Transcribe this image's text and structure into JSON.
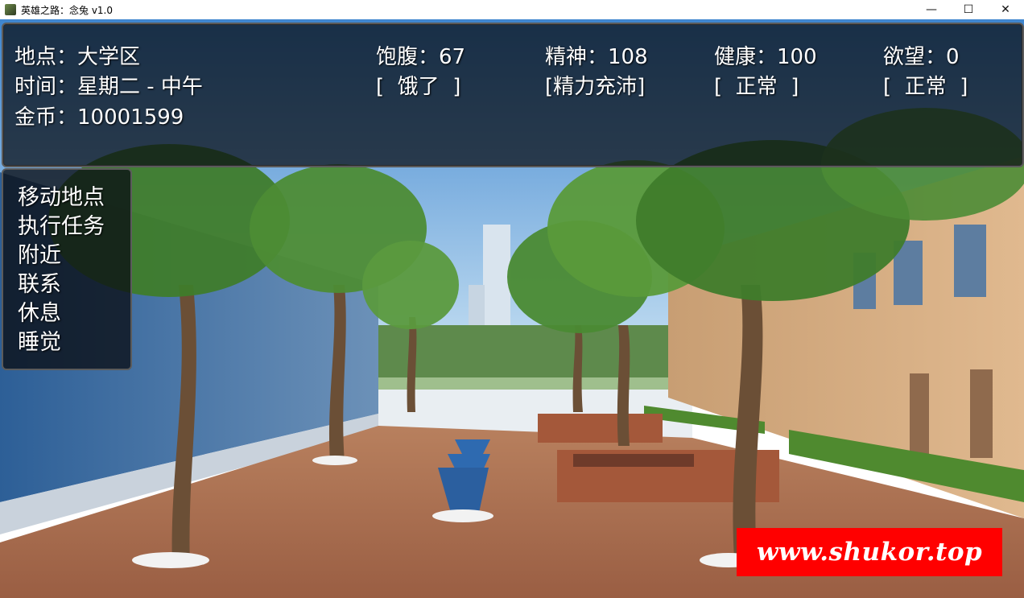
{
  "window": {
    "title": "英雄之路：念兔 v1.0",
    "minimize": "—",
    "maximize": "☐",
    "close": "✕"
  },
  "status": {
    "location": "地点：大学区",
    "time": "时间：星期二 - 中午",
    "gold": "金币：10001599",
    "satiety": "饱腹：67",
    "satiety_state": "[  饿了  ]",
    "spirit": "精神：108",
    "spirit_state": "[精力充沛]",
    "health": "健康：100",
    "health_state": "[  正常  ]",
    "desire": "欲望：0",
    "desire_state": "[  正常  ]"
  },
  "menu": {
    "items": [
      "移动地点",
      "执行任务",
      "附近",
      "联系",
      "休息",
      "睡觉"
    ]
  },
  "watermark": "www.shukor.top"
}
